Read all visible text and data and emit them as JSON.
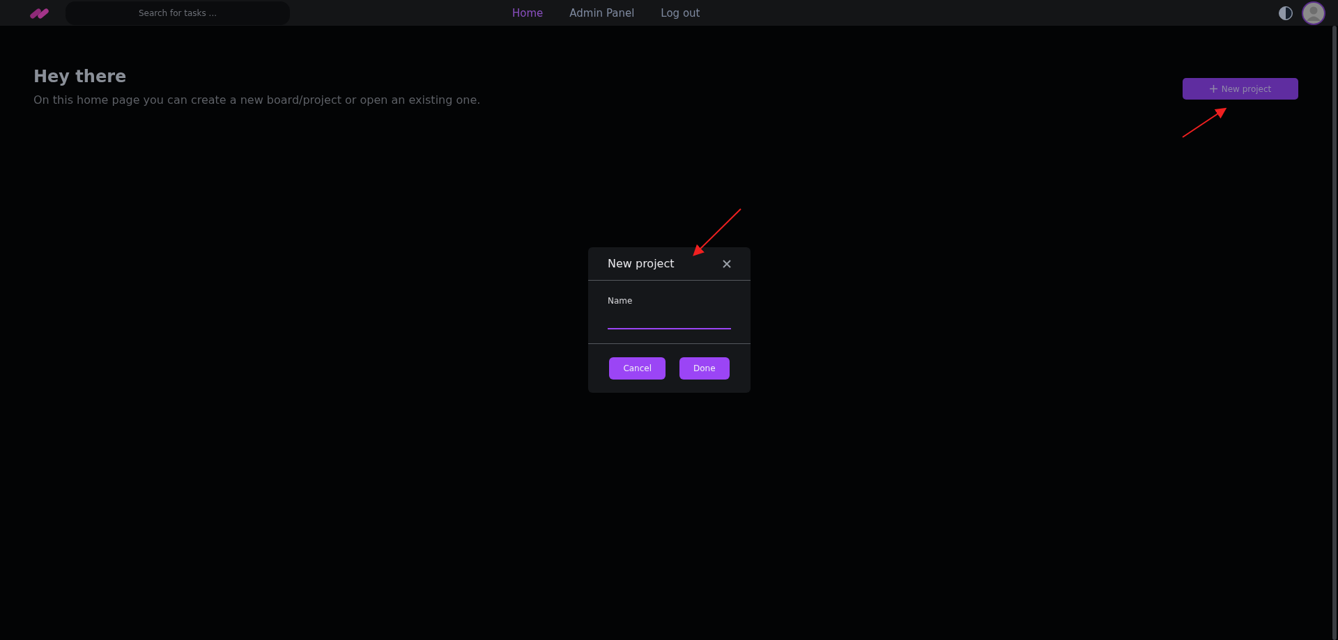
{
  "topbar": {
    "search": {
      "placeholder": "Search for tasks ..."
    },
    "nav": [
      {
        "label": "Home",
        "selected": true
      },
      {
        "label": "Admin Panel",
        "selected": false
      },
      {
        "label": "Log out",
        "selected": false
      }
    ]
  },
  "header": {
    "title": "Hey there",
    "subtitle": "On this home page you can create a new board/project or open an existing one.",
    "button": "New project"
  },
  "dialog": {
    "title": "New project",
    "field_label": "Name",
    "buttons": [
      "Cancel",
      "Done"
    ]
  }
}
